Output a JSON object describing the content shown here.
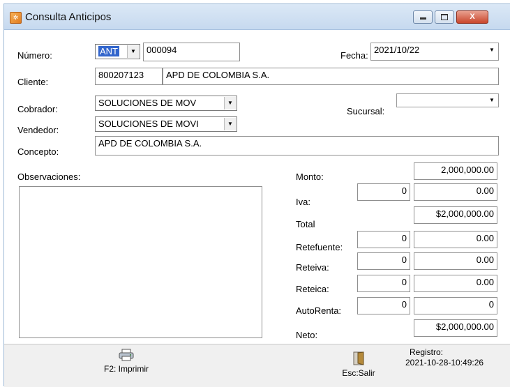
{
  "window": {
    "title": "Consulta Anticipos",
    "controls": {
      "minimize": "",
      "maximize": "",
      "close": "X"
    }
  },
  "form": {
    "numero_label": "Número:",
    "numero_type": "ANT",
    "numero_value": "000094",
    "fecha_label": "Fecha:",
    "fecha_value": "2021/10/22",
    "cliente_label": "Cliente:",
    "cliente_code": "800207123",
    "cliente_name": "APD DE COLOMBIA S.A.",
    "cobrador_label": "Cobrador:",
    "cobrador_value": "SOLUCIONES DE MOV",
    "sucursal_label": "Sucursal:",
    "sucursal_value": "",
    "vendedor_label": "Vendedor:",
    "vendedor_value": "SOLUCIONES DE MOVI",
    "concepto_label": "Concepto:",
    "concepto_value": "APD DE COLOMBIA S.A.",
    "observaciones_label": "Observaciones:"
  },
  "amounts": {
    "monto_label": "Monto:",
    "monto_value": "2,000,000.00",
    "iva_label": "Iva:",
    "iva_pct": "0",
    "iva_value": "0.00",
    "total_label": "Total",
    "total_value": "$2,000,000.00",
    "retefuente_label": "Retefuente:",
    "retefuente_pct": "0",
    "retefuente_value": "0.00",
    "reteiva_label": "Reteiva:",
    "reteiva_pct": "0",
    "reteiva_value": "0.00",
    "reteica_label": "Reteica:",
    "reteica_pct": "0",
    "reteica_value": "0.00",
    "autorenta_label": "AutoRenta:",
    "autorenta_pct": "0",
    "autorenta_value": "0",
    "neto_label": "Neto:",
    "neto_value": "$2,000,000.00"
  },
  "footer": {
    "print_label": "F2: Imprimir",
    "exit_label": "Esc:Salir",
    "registro_label": "Registro:",
    "registro_value": "2021-10-28-10:49:26"
  },
  "icons": {
    "app": "app-icon",
    "print": "printer-icon",
    "exit": "door-icon"
  }
}
